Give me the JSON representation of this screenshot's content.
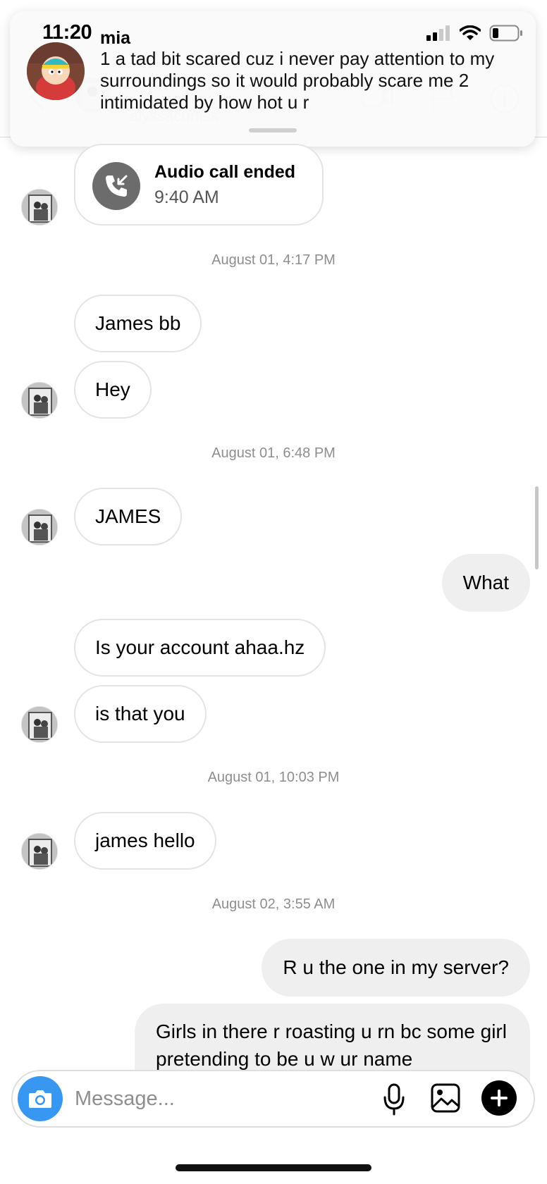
{
  "status_bar": {
    "time": "11:20"
  },
  "header": {
    "username": "alyssacurtiss"
  },
  "notification": {
    "sender": "mia",
    "text": "1 a tad bit scared cuz i never pay attention to my surroundings so it would probably scare me 2 intimidated by how hot u r"
  },
  "call": {
    "title": "Audio call ended",
    "time": "9:40 AM"
  },
  "timestamps": {
    "t1": "August 01, 4:17 PM",
    "t2": "August 01, 6:48 PM",
    "t3": "August 01, 10:03 PM",
    "t4": "August 02, 3:55 AM"
  },
  "messages": {
    "m1": "James bb",
    "m2": "Hey",
    "m3": "JAMES",
    "m4": "What",
    "m5": "Is your account ahaa.hz",
    "m6": "is that you",
    "m7": "james hello",
    "m8": "R u the one in my server?",
    "m9": "Girls in there r roasting u rn bc some girl pretending to be u w ur name"
  },
  "composer": {
    "placeholder": "Message..."
  },
  "colors": {
    "accent": "#3897f0",
    "bubble_out": "#efefef",
    "timestamp": "#8e8e8e"
  }
}
